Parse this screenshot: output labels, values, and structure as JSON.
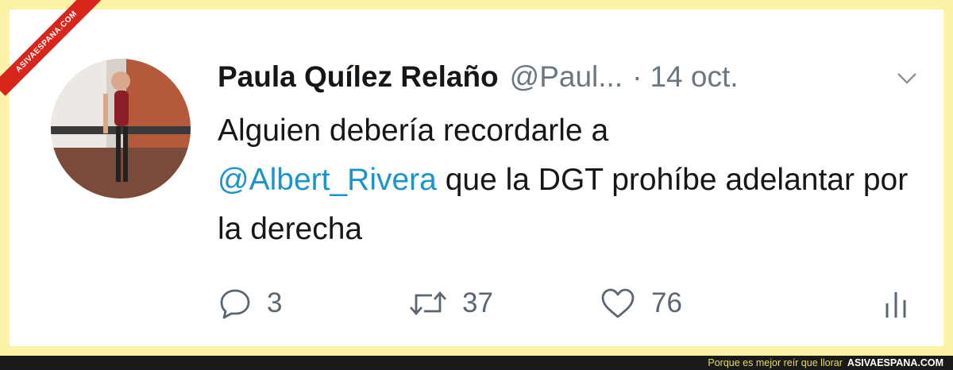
{
  "watermark": {
    "text": "ASIVAESPANA.COM"
  },
  "tweet": {
    "author_name": "Paula Quílez Relaño",
    "author_handle": "@Paul...",
    "separator": "·",
    "date": "14 oct.",
    "text_part1": "Alguien debería recordarle a",
    "mention": "@Albert_Rivera",
    "text_part2": " que la DGT prohíbe adelantar por la derecha",
    "replies": "3",
    "retweets": "37",
    "likes": "76"
  },
  "icons": {
    "reply": "reply-icon",
    "retweet": "retweet-icon",
    "like": "heart-icon",
    "stats": "stats-icon",
    "menu": "chevron-down-icon"
  },
  "colors": {
    "mention": "#1b95c9",
    "background": "#fdf3a7",
    "footer_brand": "#e9dc5a"
  },
  "footer": {
    "slogan": "Porque es mejor reír que llorar",
    "site": "ASIVAESPANA.COM"
  }
}
